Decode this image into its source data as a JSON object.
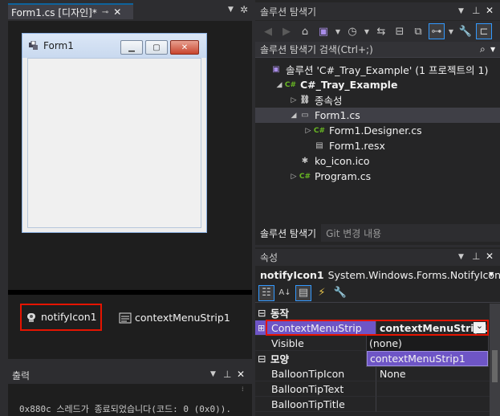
{
  "designer": {
    "tab_label": "Form1.cs [디자인]*",
    "form_title": "Form1"
  },
  "tray": {
    "items": [
      {
        "label": "notifyIcon1",
        "icon": "notify-icon"
      },
      {
        "label": "contextMenuStrip1",
        "icon": "context-menu-icon"
      }
    ]
  },
  "output": {
    "title": "출력",
    "line": "0x880c 스레드가 종료되었습니다(코드: 0 (0x0))."
  },
  "solution_explorer": {
    "title": "솔루션 탐색기",
    "search_placeholder": "솔루션 탐색기 검색(Ctrl+;)",
    "tree": [
      {
        "label": "솔루션 'C#_Tray_Example' (1 프로젝트의 1)",
        "icon": "solution-icon",
        "indent": 0,
        "bold": false,
        "expander": ""
      },
      {
        "label": "C#_Tray_Example",
        "icon": "csharp-project-icon",
        "indent": 1,
        "bold": true,
        "expander": "expanded"
      },
      {
        "label": "종속성",
        "icon": "dependencies-icon",
        "indent": 2,
        "bold": false,
        "expander": "collapsed"
      },
      {
        "label": "Form1.cs",
        "icon": "form-icon",
        "indent": 2,
        "bold": false,
        "expander": "expanded",
        "selected": true
      },
      {
        "label": "Form1.Designer.cs",
        "icon": "csharp-file-icon",
        "indent": 3,
        "bold": false,
        "expander": "collapsed"
      },
      {
        "label": "Form1.resx",
        "icon": "resx-file-icon",
        "indent": 3,
        "bold": false,
        "expander": ""
      },
      {
        "label": "ko_icon.ico",
        "icon": "ico-file-icon",
        "indent": 2,
        "bold": false,
        "expander": ""
      },
      {
        "label": "Program.cs",
        "icon": "csharp-file-icon",
        "indent": 2,
        "bold": false,
        "expander": "collapsed"
      }
    ],
    "bottom_tabs": [
      "솔루션 탐색기",
      "Git 변경 내용"
    ]
  },
  "properties": {
    "title": "속성",
    "object_name": "notifyIcon1",
    "object_type": "System.Windows.Forms.NotifyIcon",
    "categories": [
      {
        "label": "동작",
        "rows": [
          {
            "name": "ContextMenuStrip",
            "value": "contextMenuStrip1"
          },
          {
            "name": "Visible",
            "value": ""
          }
        ]
      },
      {
        "label": "모양",
        "rows": [
          {
            "name": "BalloonTipIcon",
            "value": "None"
          },
          {
            "name": "BalloonTipText",
            "value": ""
          },
          {
            "name": "BalloonTipTitle",
            "value": ""
          }
        ]
      }
    ],
    "dropdown_options": [
      "(none)",
      "contextMenuStrip1"
    ],
    "dropdown_selected": "contextMenuStrip1"
  },
  "colors": {
    "accent_highlight": "#e51400",
    "dropdown_selection": "#6e55c6",
    "selected_value_bg": "#6e55c6"
  }
}
